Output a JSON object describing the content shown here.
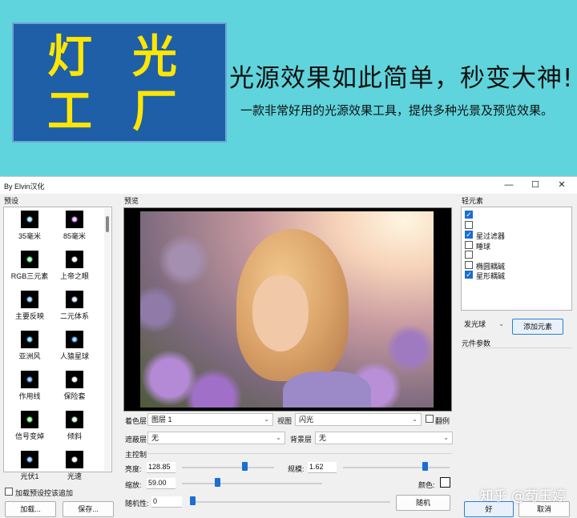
{
  "banner": {
    "logo_chars": [
      "灯",
      "光",
      "工",
      "厂"
    ],
    "headline": "光源效果如此简单，秒变大神!",
    "subline": "一款非常好用的光源效果工具，提供多种光景及预览效果。"
  },
  "window": {
    "title": "By Elvin汉化",
    "controls": [
      "—",
      "☐",
      "✕"
    ]
  },
  "presets": {
    "section_label": "预设",
    "items": [
      {
        "label": "35毫米",
        "color": "#9fd8ff"
      },
      {
        "label": "85毫米",
        "color": "#e59cff"
      },
      {
        "label": "RGB三元素",
        "color": "#7fff9c"
      },
      {
        "label": "上帝之眼",
        "color": "#ffffff"
      },
      {
        "label": "主要反映",
        "color": "#8fc4ff"
      },
      {
        "label": "二元体系",
        "color": "#cfe4ff"
      },
      {
        "label": "亚洲风",
        "color": "#66ccff"
      },
      {
        "label": "人猿星球",
        "color": "#5fb8ff"
      },
      {
        "label": "作用线",
        "color": "#6ea6ff"
      },
      {
        "label": "保险套",
        "color": "#ffffff"
      },
      {
        "label": "信号变焯",
        "color": "#88ff88"
      },
      {
        "label": "倾斜",
        "color": "#d2ffd8"
      },
      {
        "label": "光伏1",
        "color": "#7fb8ff"
      },
      {
        "label": "光速",
        "color": "#ffffff"
      }
    ],
    "checkbox_label": "加载预设控该追加",
    "load_button": "加载...",
    "save_button": "保存..."
  },
  "preview": {
    "section_label": "预览"
  },
  "layers": {
    "color_layer_label": "着色层",
    "color_layer_value": "图层 1",
    "view_label": "视图",
    "view_value": "闪光",
    "flip_label": "翻例",
    "mask_layer_label": "遮蔽层",
    "mask_layer_value": "无",
    "background_layer_label": "背景层",
    "background_layer_value": "无"
  },
  "main_controls": {
    "section_label": "主控制",
    "brightness_label": "亮度:",
    "brightness_value": "128.85",
    "brightness_level": 0.6,
    "scale_label": "规模:",
    "scale_value": "1.62",
    "scale_level": 0.72,
    "zoom_label": "缩放:",
    "zoom_value": "59.00",
    "zoom_level": 0.25,
    "color_label": "颜色:",
    "random_label": "随机性:",
    "random_value": "0",
    "random_level": 0.0,
    "random_button": "随机"
  },
  "light_elements": {
    "section_label": "轻元素",
    "items": [
      {
        "label": "",
        "checked": true
      },
      {
        "label": "",
        "checked": false
      },
      {
        "label": "星过滤器",
        "checked": true
      },
      {
        "label": "睡球",
        "checked": false
      },
      {
        "label": "",
        "checked": false
      },
      {
        "label": "椭圆耦碱",
        "checked": false
      },
      {
        "label": "星形耦碱",
        "checked": true
      }
    ],
    "type_select": "发光球",
    "add_button": "添加元素",
    "params_label": "元件参数"
  },
  "dialog": {
    "ok_button": "好",
    "cancel_button": "取消"
  },
  "watermark": "知乎 @苟玉婷"
}
